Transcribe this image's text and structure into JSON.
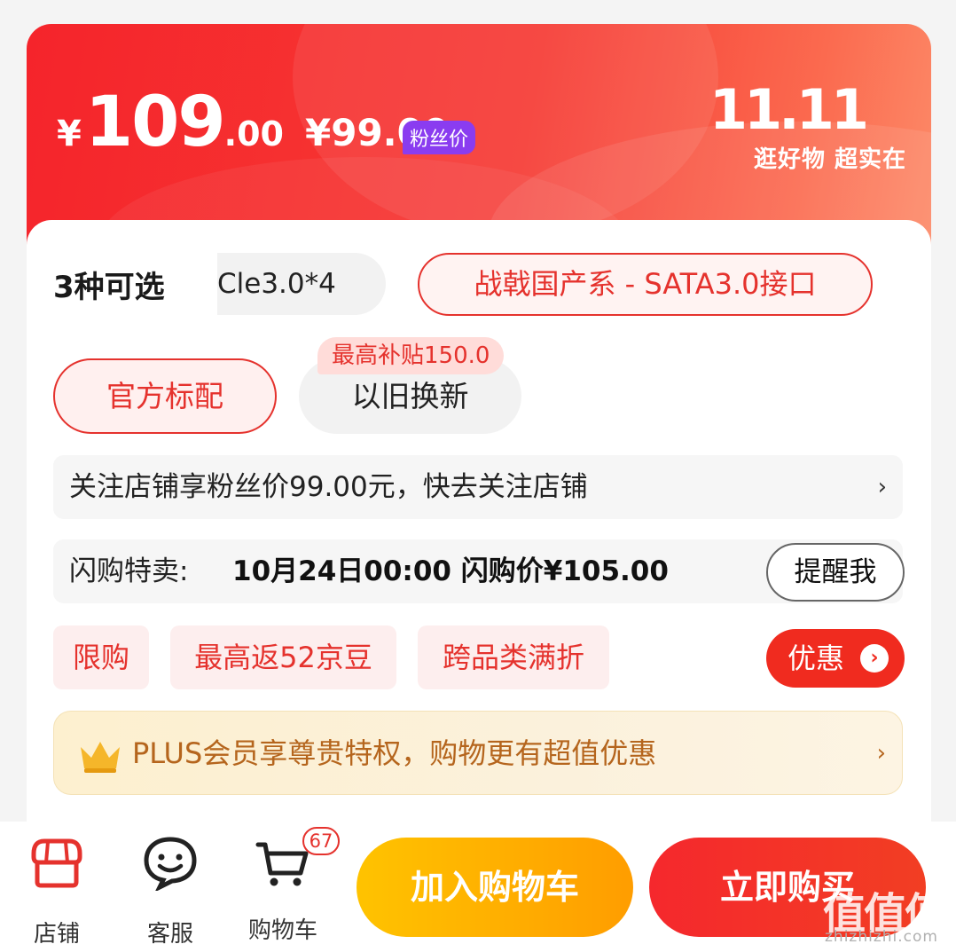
{
  "banner": {
    "currency": "¥",
    "price_int": "109",
    "price_dec": ".00",
    "fan_price": "¥99.00",
    "fan_badge": "粉丝价",
    "event_logo": "11.11",
    "event_slogan": "逛好物 超实在"
  },
  "variants": {
    "count_label": "3种可选",
    "option_partial": "Cle3.0*4",
    "option_selected": "战戟国产系 - SATA3.0接口"
  },
  "service": {
    "official": "官方标配",
    "tradein": "以旧换新",
    "subsidy": "最高补贴150.0"
  },
  "follow_row": {
    "text": "关注店铺享粉丝价99.00元，快去关注店铺",
    "chevron": "›"
  },
  "flash_row": {
    "label": "闪购特卖:",
    "info": "10月24日00:00 闪购价¥105.00",
    "remind": "提醒我"
  },
  "tags": [
    "限购",
    "最高返52京豆",
    "跨品类满折"
  ],
  "promo_button": {
    "label": "优惠",
    "arrow": "›"
  },
  "plus_row": {
    "text": "PLUS会员享尊贵特权，购物更有超值优惠",
    "chevron": "›",
    "icon": "crown-icon"
  },
  "bottom_nav": {
    "shop": "店铺",
    "service": "客服",
    "cart": "购物车",
    "cart_count": "67"
  },
  "actions": {
    "add_to_cart": "加入购物车",
    "buy_now": "立即购买"
  },
  "watermark": {
    "logo": "值值值",
    "url": "zhizhizhi.com"
  },
  "colors": {
    "brand_red": "#e5322d",
    "cart_yellow": "#ffb300",
    "plus_gold": "#b5651d"
  }
}
